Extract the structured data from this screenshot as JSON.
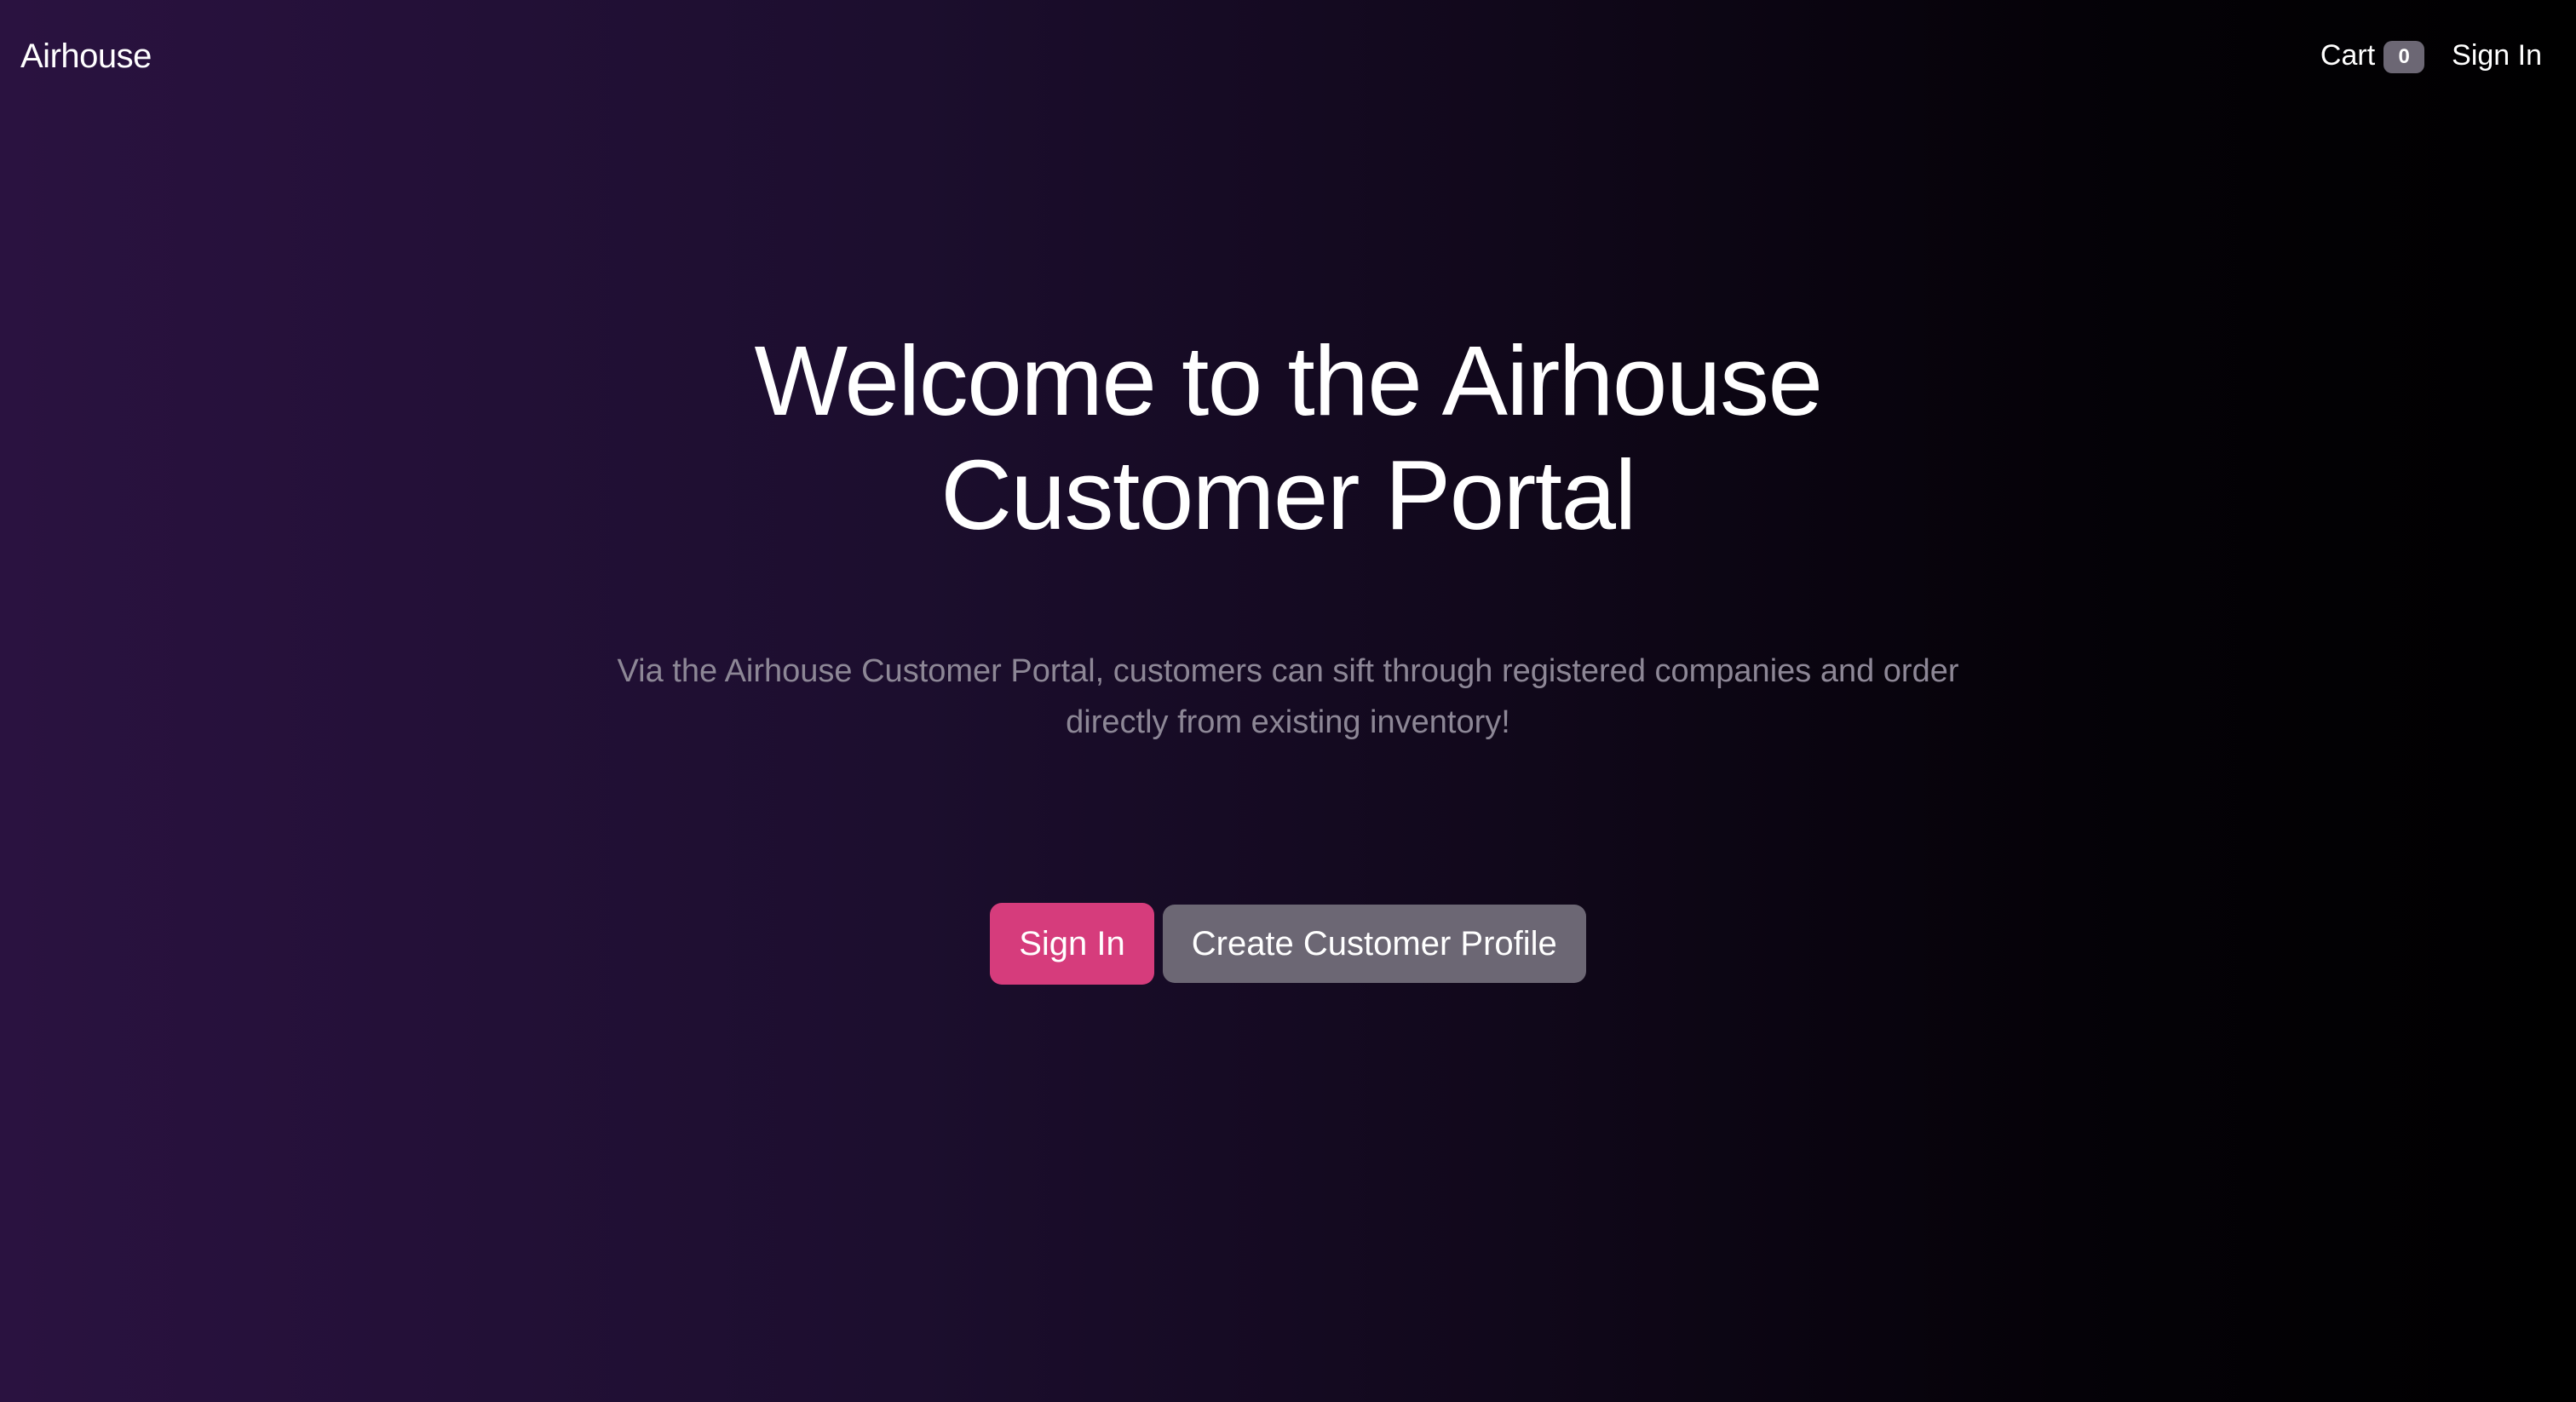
{
  "nav": {
    "brand": "Airhouse",
    "cart_label": "Cart",
    "cart_count": "0",
    "signin_label": "Sign In"
  },
  "hero": {
    "title": "Welcome to the Airhouse Customer Portal",
    "subtitle": "Via the Airhouse Customer Portal, customers can sift through registered companies and order directly from existing inventory!",
    "primary_button": "Sign In",
    "secondary_button": "Create Customer Profile"
  },
  "colors": {
    "primary_button": "#d63c7c",
    "secondary_button": "#6c6774",
    "background_start": "#2a1240",
    "background_end": "#000000",
    "subtitle_text": "#8d8796"
  }
}
